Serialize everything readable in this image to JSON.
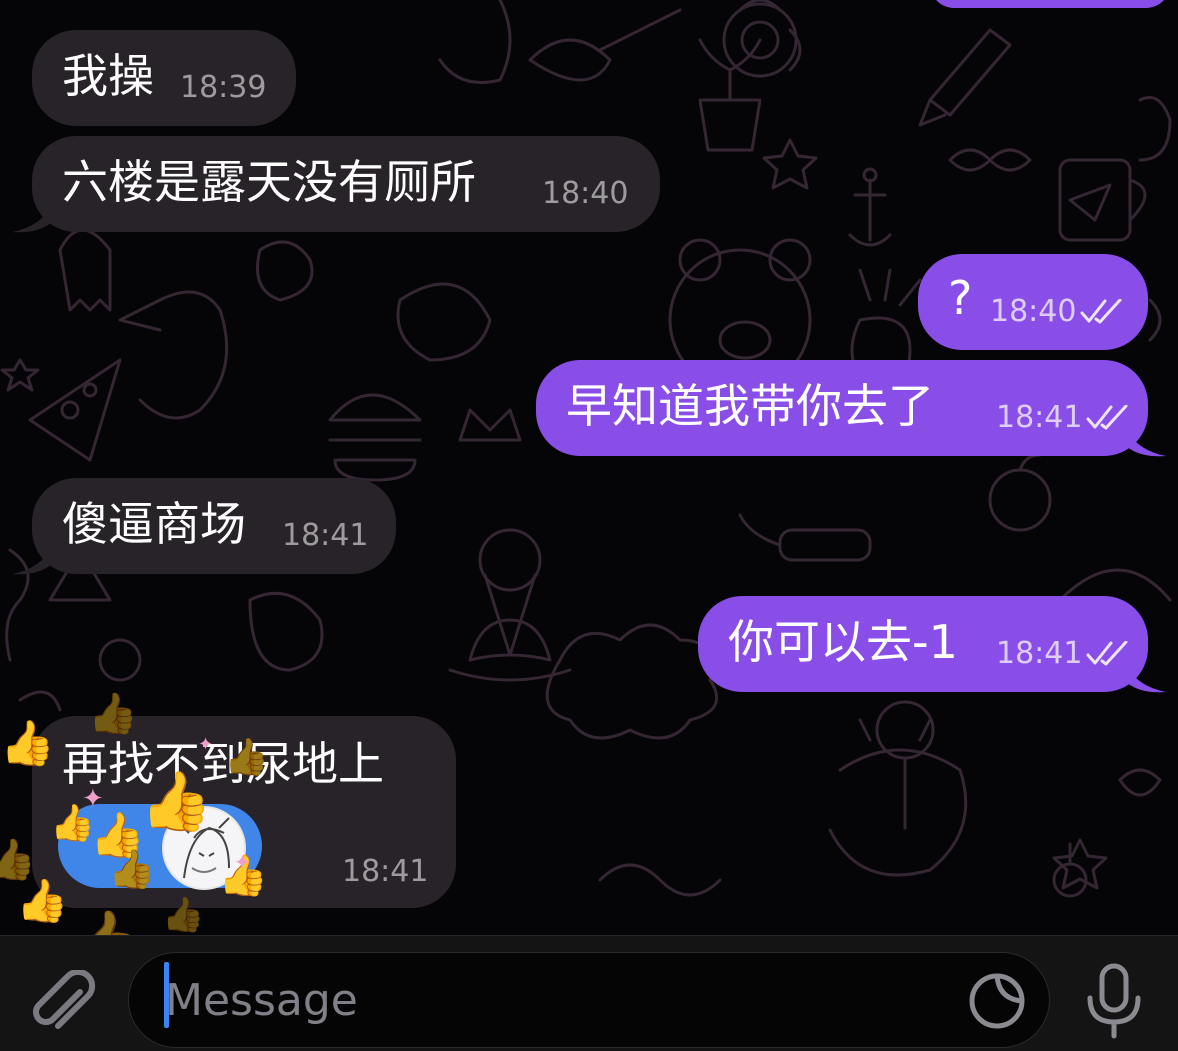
{
  "messages": [
    {
      "id": "m1",
      "side": "in",
      "text": "我操",
      "time": "18:39"
    },
    {
      "id": "m2",
      "side": "in",
      "text": "六楼是露天没有厕所",
      "time": "18:40"
    },
    {
      "id": "m3",
      "side": "out",
      "text": "?",
      "time": "18:40",
      "status": "read"
    },
    {
      "id": "m4",
      "side": "out",
      "text": "早知道我带你去了",
      "time": "18:41",
      "status": "read"
    },
    {
      "id": "m5",
      "side": "in",
      "text": "傻逼商场",
      "time": "18:41"
    },
    {
      "id": "m6",
      "side": "out",
      "text": "你可以去-1",
      "time": "18:41",
      "status": "read"
    },
    {
      "id": "m7",
      "side": "in",
      "text": "再找不到尿地上",
      "time": "18:41",
      "reaction": {
        "emoji": "👍",
        "avatar_icon": "avatar-anime-sketch"
      }
    }
  ],
  "reaction_effect": {
    "emoji": "👍",
    "sparkle": "✦"
  },
  "composer": {
    "placeholder": "Message",
    "attach_icon": "paperclip-icon",
    "sticker_icon": "sticker-icon",
    "mic_icon": "microphone-icon"
  },
  "colors": {
    "incoming_bubble": "#282229",
    "outgoing_bubble": "#8a4ee8",
    "reaction_pill": "#3f86e8",
    "caret": "#3b82f6"
  }
}
